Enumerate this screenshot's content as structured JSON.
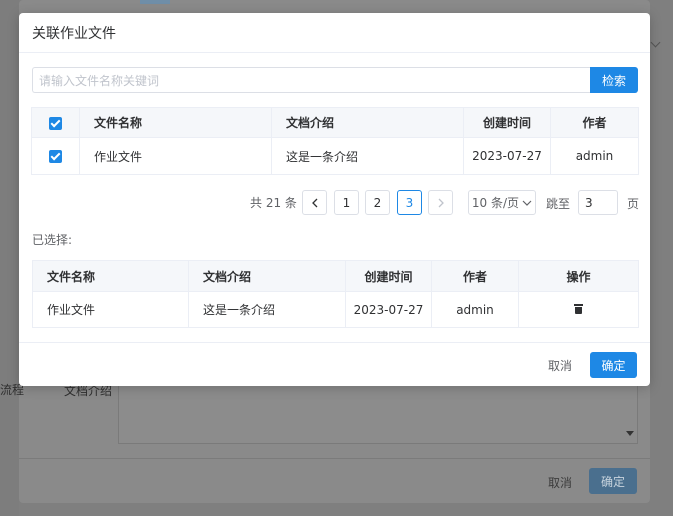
{
  "background": {
    "doc_intro_label": "文档介绍",
    "side_label": "流程",
    "cancel_label": "取消",
    "ok_label": "确定"
  },
  "modal": {
    "title": "关联作业文件",
    "search": {
      "placeholder": "请输入文件名称关键词",
      "button": "检索"
    },
    "table": {
      "headers": [
        "文件名称",
        "文档介绍",
        "创建时间",
        "作者"
      ],
      "rows": [
        {
          "checked": true,
          "name": "作业文件",
          "intro": "这是一条介绍",
          "created": "2023-07-27",
          "author": "admin"
        }
      ]
    },
    "pagination": {
      "total": "共 21 条",
      "pages": [
        "1",
        "2",
        "3"
      ],
      "current": "3",
      "page_size": "10 条/页",
      "goto_label": "跳至",
      "goto_value": "3",
      "page_unit": "页"
    },
    "selected_label": "已选择:",
    "selected_table": {
      "headers": [
        "文件名称",
        "文档介绍",
        "创建时间",
        "作者",
        "操作"
      ],
      "rows": [
        {
          "name": "作业文件",
          "intro": "这是一条介绍",
          "created": "2023-07-27",
          "author": "admin"
        }
      ]
    },
    "footer": {
      "cancel": "取消",
      "ok": "确定"
    }
  },
  "colors": {
    "primary": "#1e88e5",
    "overlay": "#7f7f7f"
  }
}
